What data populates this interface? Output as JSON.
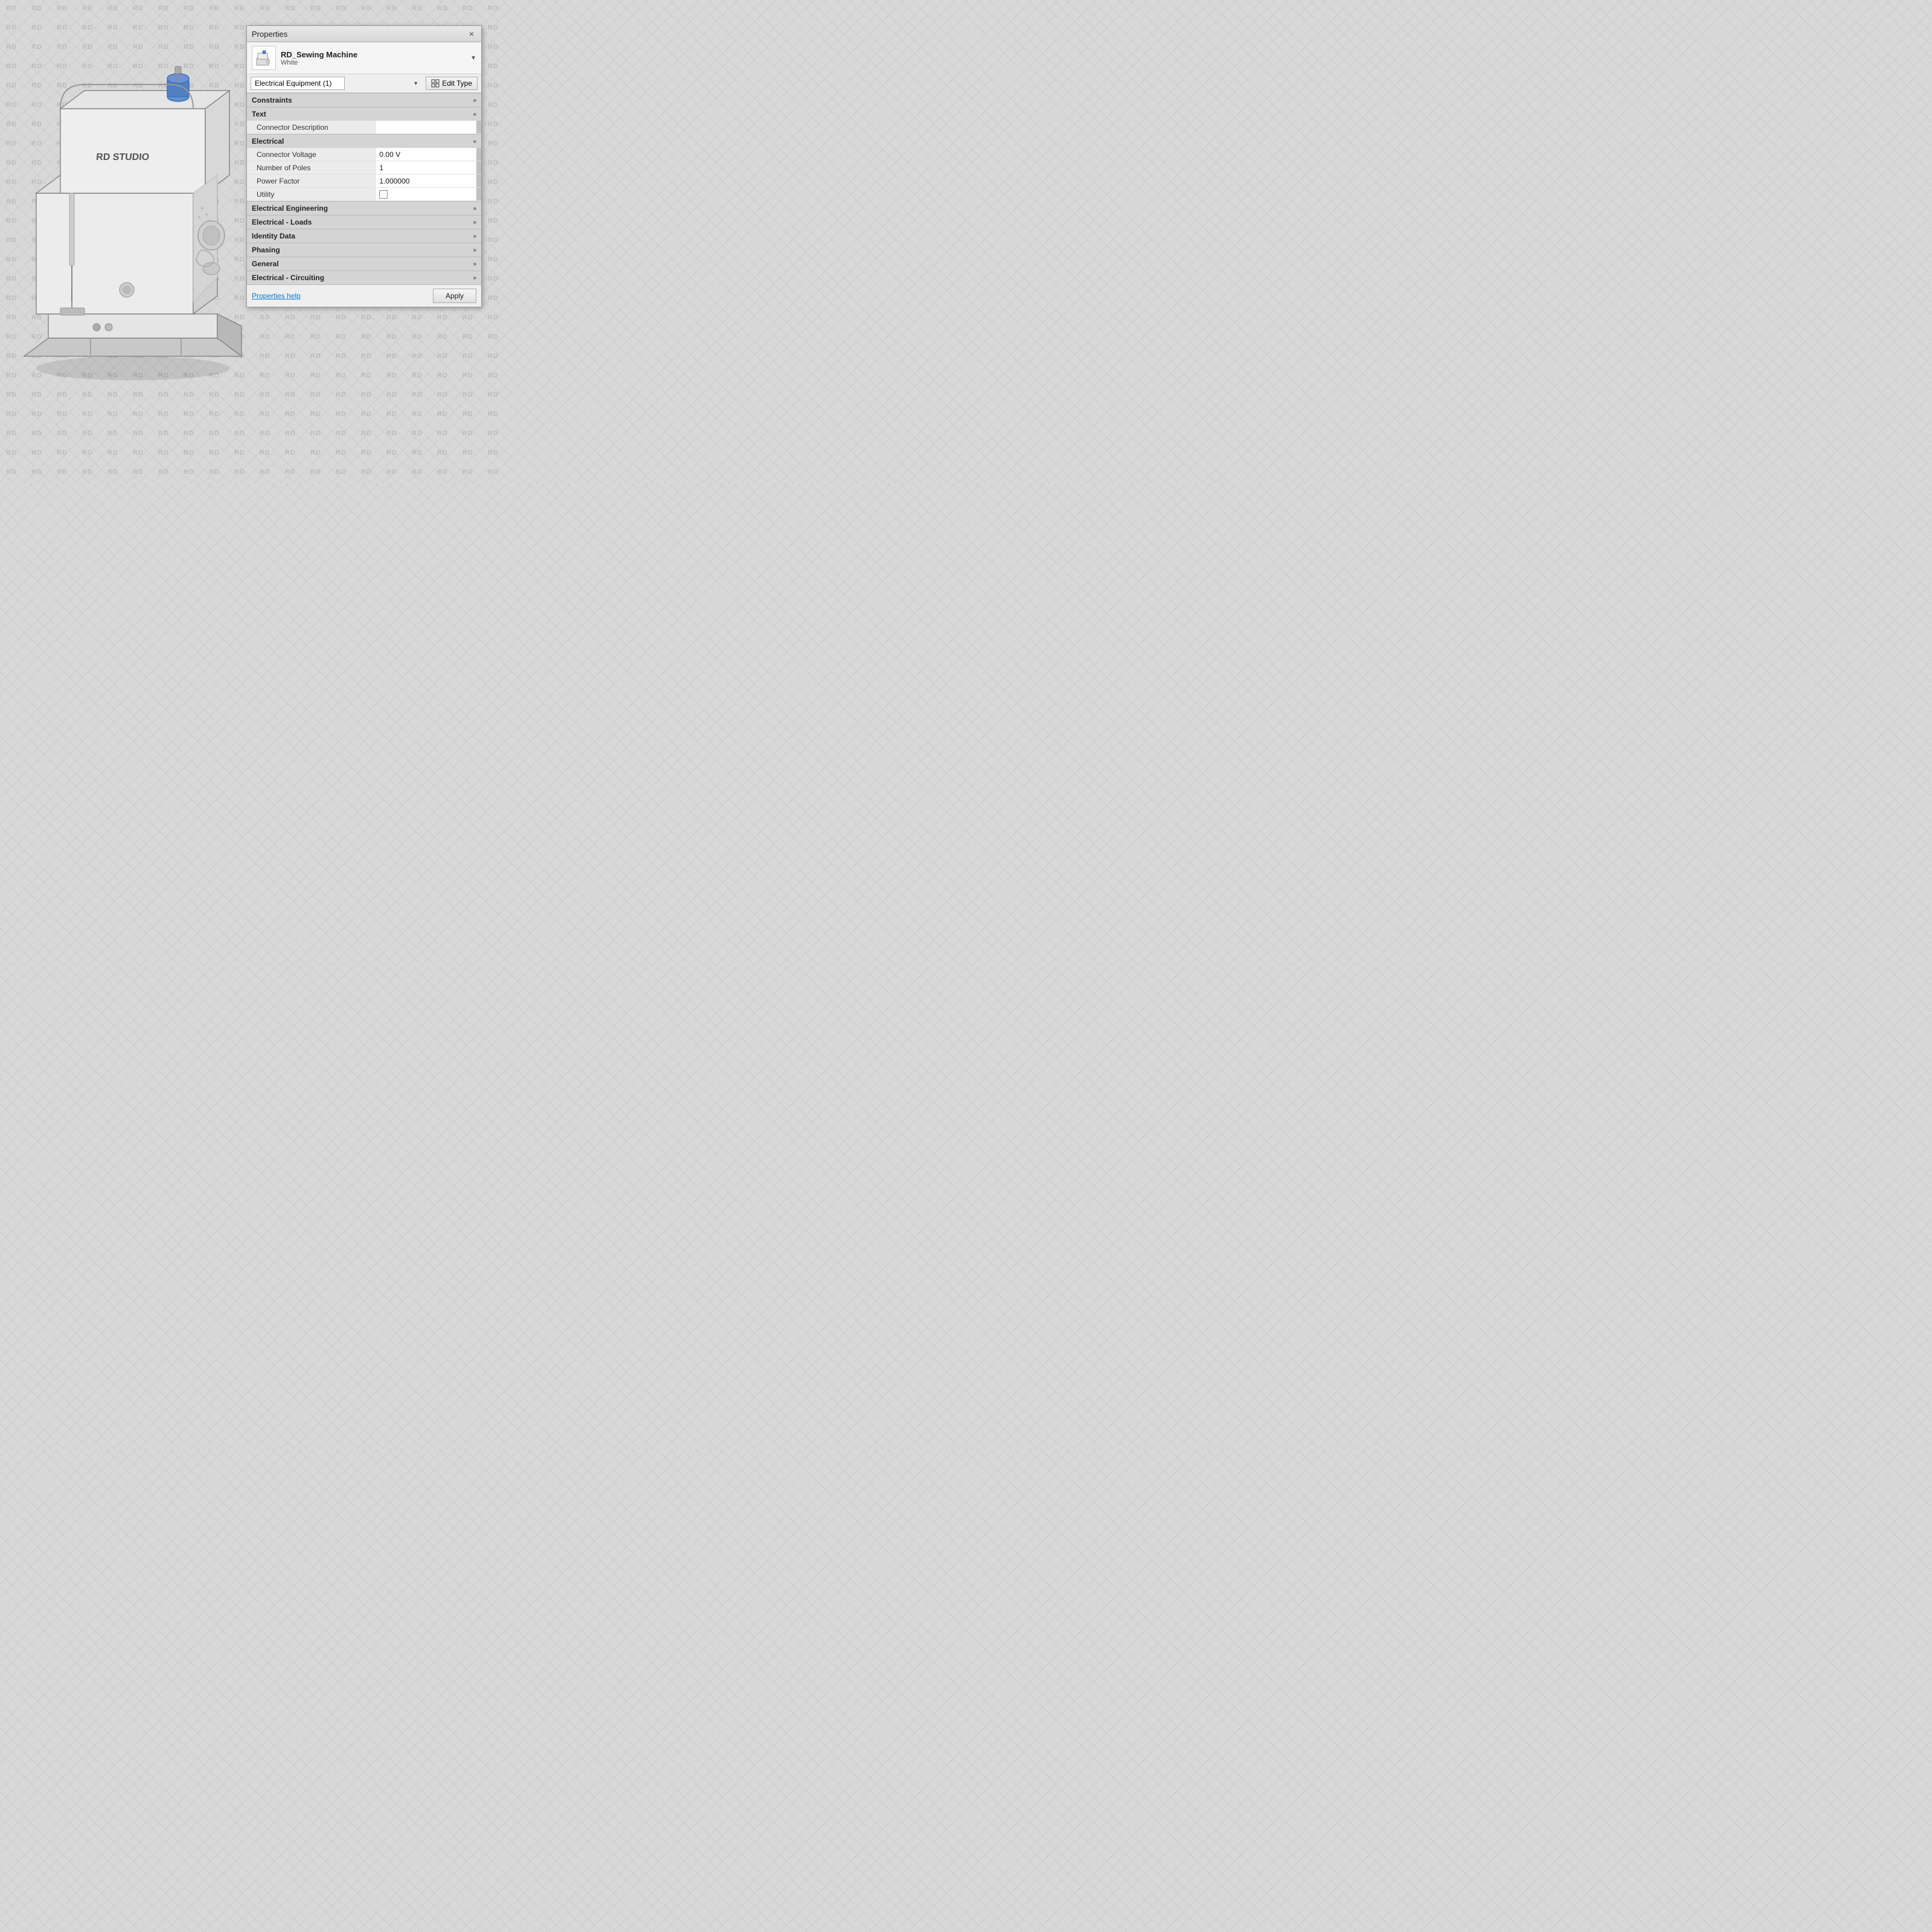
{
  "background": {
    "watermark_text": "RD"
  },
  "canvas": {
    "title": "RD STUDIO"
  },
  "properties_panel": {
    "title": "Properties",
    "close_label": "×",
    "item": {
      "name": "RD_Sewing Machine",
      "sub": "White"
    },
    "dropdown": {
      "selected": "Electrical Equipment (1)",
      "options": [
        "Electrical Equipment (1)"
      ]
    },
    "edit_type_label": "Edit Type",
    "sections": [
      {
        "id": "constraints",
        "label": "Constraints",
        "state": "collapsed",
        "properties": []
      },
      {
        "id": "text",
        "label": "Text",
        "state": "expanded",
        "properties": [
          {
            "label": "Connector Description",
            "value": "",
            "type": "text"
          }
        ]
      },
      {
        "id": "electrical",
        "label": "Electrical",
        "state": "expanded",
        "properties": [
          {
            "label": "Connector Voltage",
            "value": "0.00 V",
            "type": "text"
          },
          {
            "label": "Number of Poles",
            "value": "1",
            "type": "text"
          },
          {
            "label": "Power Factor",
            "value": "1.000000",
            "type": "text"
          },
          {
            "label": "Utility",
            "value": "",
            "type": "checkbox"
          }
        ]
      },
      {
        "id": "electrical-engineering",
        "label": "Electrical Engineering",
        "state": "collapsed",
        "properties": []
      },
      {
        "id": "electrical-loads",
        "label": "Electrical - Loads",
        "state": "collapsed",
        "properties": []
      },
      {
        "id": "identity-data",
        "label": "Identity Data",
        "state": "collapsed",
        "properties": []
      },
      {
        "id": "phasing",
        "label": "Phasing",
        "state": "collapsed",
        "properties": []
      },
      {
        "id": "general",
        "label": "General",
        "state": "collapsed",
        "properties": []
      },
      {
        "id": "electrical-circuiting",
        "label": "Electrical - Circuiting",
        "state": "collapsed",
        "properties": []
      }
    ],
    "footer": {
      "help_label": "Properties help",
      "apply_label": "Apply"
    }
  }
}
